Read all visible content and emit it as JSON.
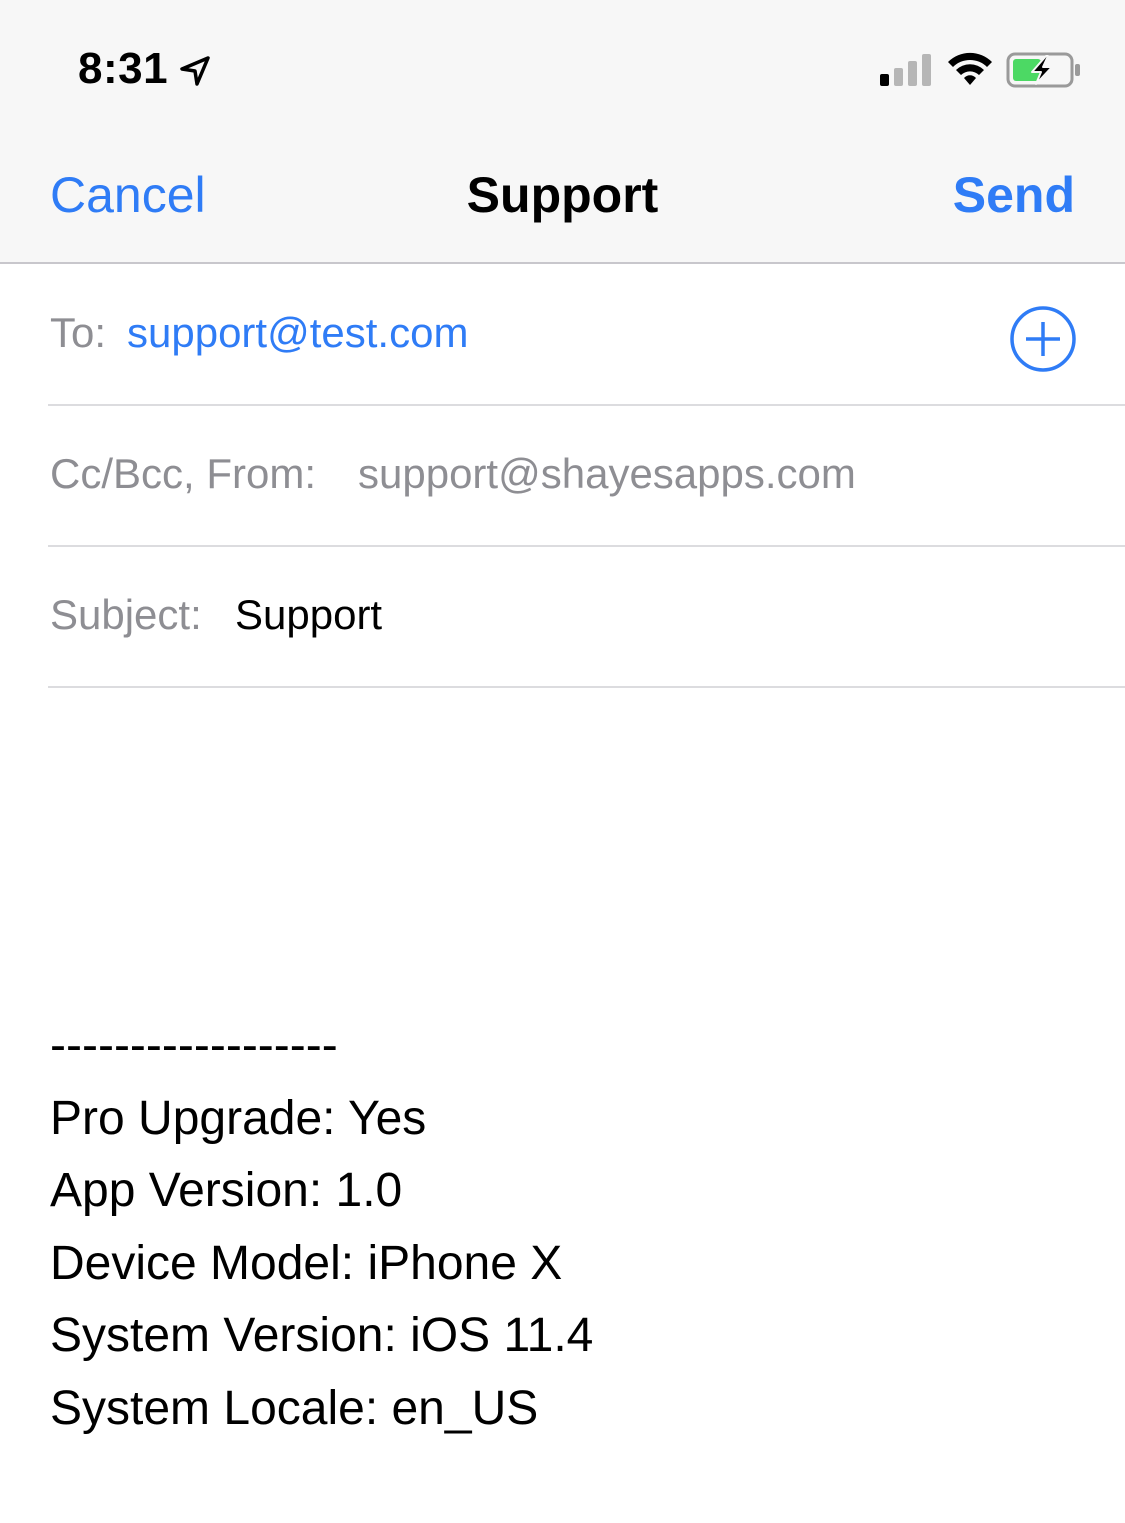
{
  "status_bar": {
    "time": "8:31",
    "location_icon": "location-arrow-icon",
    "signal_icon": "cellular-signal-icon",
    "wifi_icon": "wifi-icon",
    "battery_icon": "battery-charging-icon"
  },
  "nav": {
    "cancel_label": "Cancel",
    "title": "Support",
    "send_label": "Send"
  },
  "fields": {
    "to_label": "To:",
    "to_value": "support@test.com",
    "cc_label": "Cc/Bcc, From:",
    "cc_value": "support@shayesapps.com",
    "subject_label": "Subject:",
    "subject_value": "Support"
  },
  "body": {
    "separator": "------------------",
    "lines": [
      "Pro Upgrade: Yes",
      "App Version: 1.0",
      "Device Model: iPhone X",
      "System Version: iOS 11.4",
      "System Locale: en_US"
    ]
  },
  "colors": {
    "accent": "#2f7cf6",
    "label_gray": "#8e8e93",
    "nav_background": "#f7f7f7",
    "battery_green": "#4cd964"
  }
}
